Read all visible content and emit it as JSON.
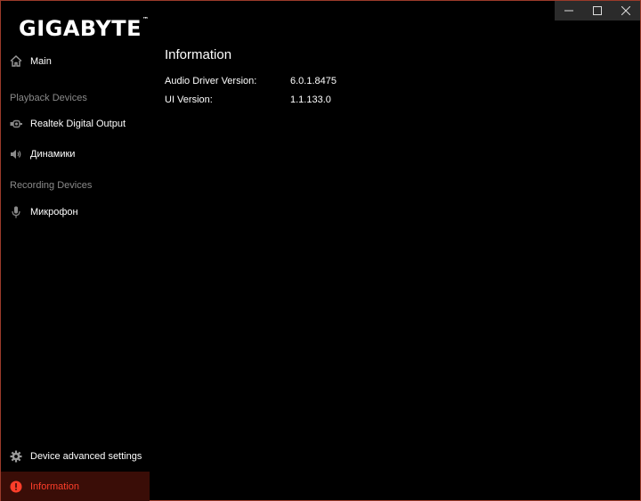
{
  "window": {
    "controls": [
      "minimize",
      "maximize",
      "close"
    ]
  },
  "sidebar": {
    "logo": "GIGABYTE",
    "logo_mark": "™",
    "main_item": {
      "label": "Main",
      "icon": "home-icon"
    },
    "playback_section": "Playback Devices",
    "playback_items": [
      {
        "label": "Realtek Digital Output",
        "icon": "digital-output-icon"
      },
      {
        "label": "Динамики",
        "icon": "speaker-icon"
      }
    ],
    "recording_section": "Recording Devices",
    "recording_items": [
      {
        "label": "Микрофон",
        "icon": "microphone-icon"
      }
    ],
    "bottom_items": [
      {
        "label": "Device advanced settings",
        "icon": "gear-icon"
      },
      {
        "label": "Information",
        "icon": "info-icon",
        "active": true
      }
    ]
  },
  "content": {
    "title": "Information",
    "rows": [
      {
        "key": "Audio Driver Version:",
        "value": "6.0.1.8475"
      },
      {
        "key": "UI Version:",
        "value": "1.1.133.0"
      }
    ]
  },
  "colors": {
    "background": "#000000",
    "accent": "#ff3e2a",
    "active_bg": "#3a0d07",
    "section_label": "#8a8a8a",
    "border": "#9a3a2a"
  }
}
